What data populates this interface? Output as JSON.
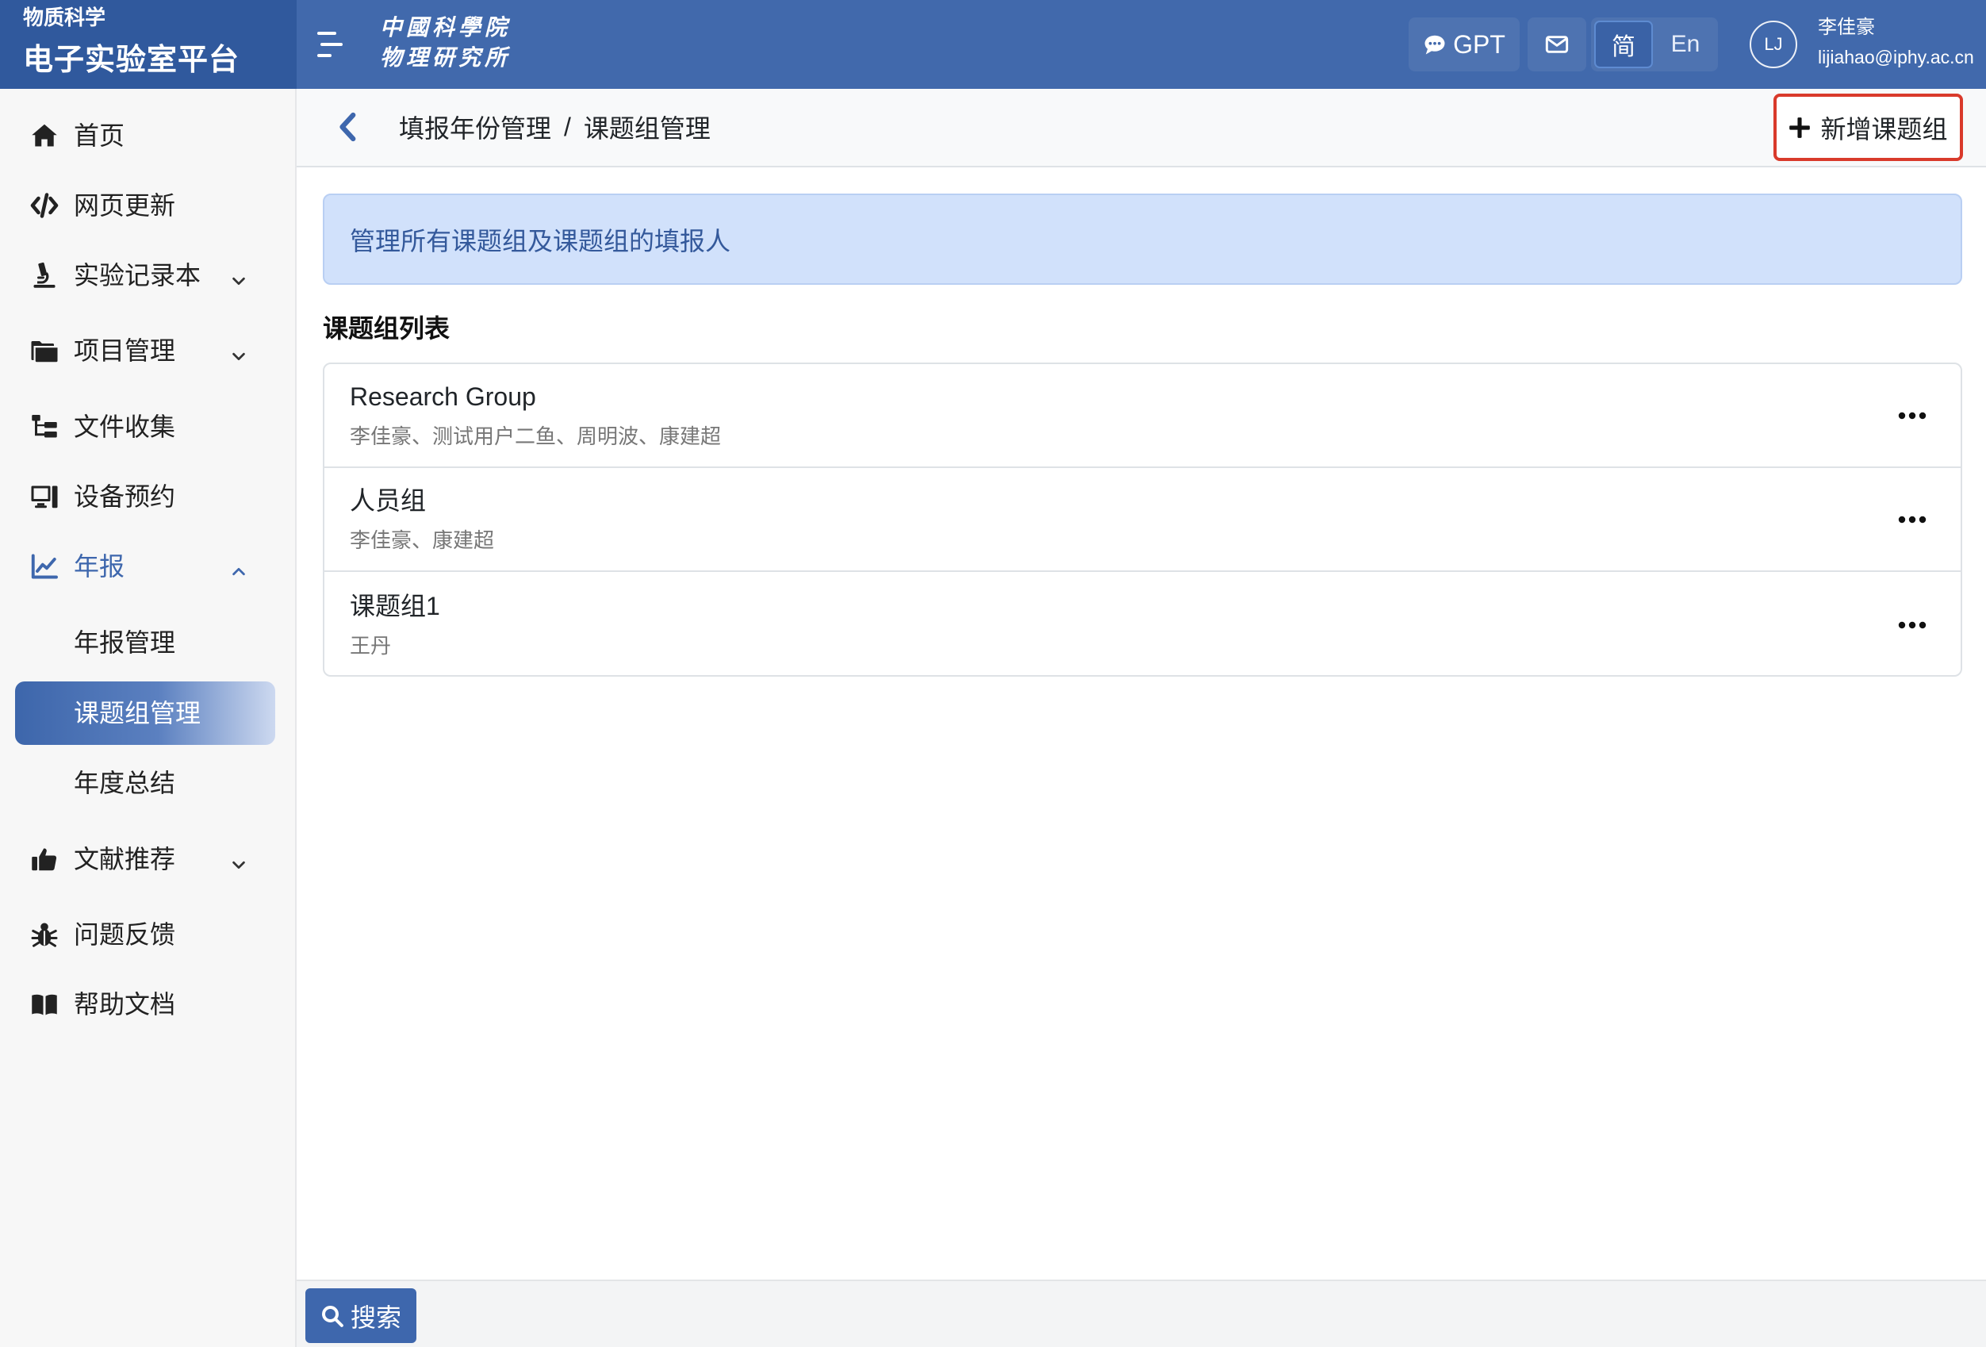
{
  "brand": {
    "org": "物质科学",
    "title": "电子实验室平台"
  },
  "header": {
    "logo": {
      "line1": "中國科學院",
      "line2": "物理研究所"
    },
    "gpt_label": "GPT",
    "languages": [
      {
        "label": "简",
        "selected": true
      },
      {
        "label": "En",
        "selected": false
      }
    ],
    "user": {
      "initials": "LJ",
      "name": "李佳豪",
      "email": "lijiahao@iphy.ac.cn"
    }
  },
  "sidebar": {
    "items": [
      {
        "label": "首页",
        "icon": "home-icon"
      },
      {
        "label": "网页更新",
        "icon": "code-icon"
      },
      {
        "label": "实验记录本",
        "icon": "microscope-icon",
        "expandable": true,
        "expanded": false
      },
      {
        "label": "项目管理",
        "icon": "folder-icon",
        "expandable": true,
        "expanded": false
      },
      {
        "label": "文件收集",
        "icon": "sitemap-icon"
      },
      {
        "label": "设备预约",
        "icon": "desktop-icon"
      },
      {
        "label": "年报",
        "icon": "chart-line-icon",
        "expandable": true,
        "expanded": true,
        "children": [
          {
            "label": "年报管理",
            "active": false
          },
          {
            "label": "课题组管理",
            "active": true
          },
          {
            "label": "年度总结",
            "active": false
          }
        ]
      },
      {
        "label": "文献推荐",
        "icon": "thumbs-up-icon",
        "expandable": true,
        "expanded": false
      },
      {
        "label": "问题反馈",
        "icon": "bug-icon"
      },
      {
        "label": "帮助文档",
        "icon": "book-icon"
      }
    ]
  },
  "breadcrumb": {
    "items": [
      "填报年份管理",
      "课题组管理"
    ],
    "separator": "/"
  },
  "toolbar": {
    "add_group_label": "新增课题组"
  },
  "alert": {
    "text": "管理所有课题组及课题组的填报人"
  },
  "group_list": {
    "heading": "课题组列表",
    "groups": [
      {
        "name": "Research Group",
        "members": "李佳豪、测试用户二鱼、周明波、康建超"
      },
      {
        "name": "人员组",
        "members": "李佳豪、康建超"
      },
      {
        "name": "课题组1",
        "members": "王丹"
      }
    ]
  },
  "footer": {
    "search_label": "搜索"
  },
  "colors": {
    "header_bg": "#4169ac",
    "brand_bg": "#30599d",
    "accent": "#3e67ad",
    "alert_bg": "#d1e1fb",
    "alert_text": "#34599b",
    "highlight_border": "#d93a2b"
  }
}
